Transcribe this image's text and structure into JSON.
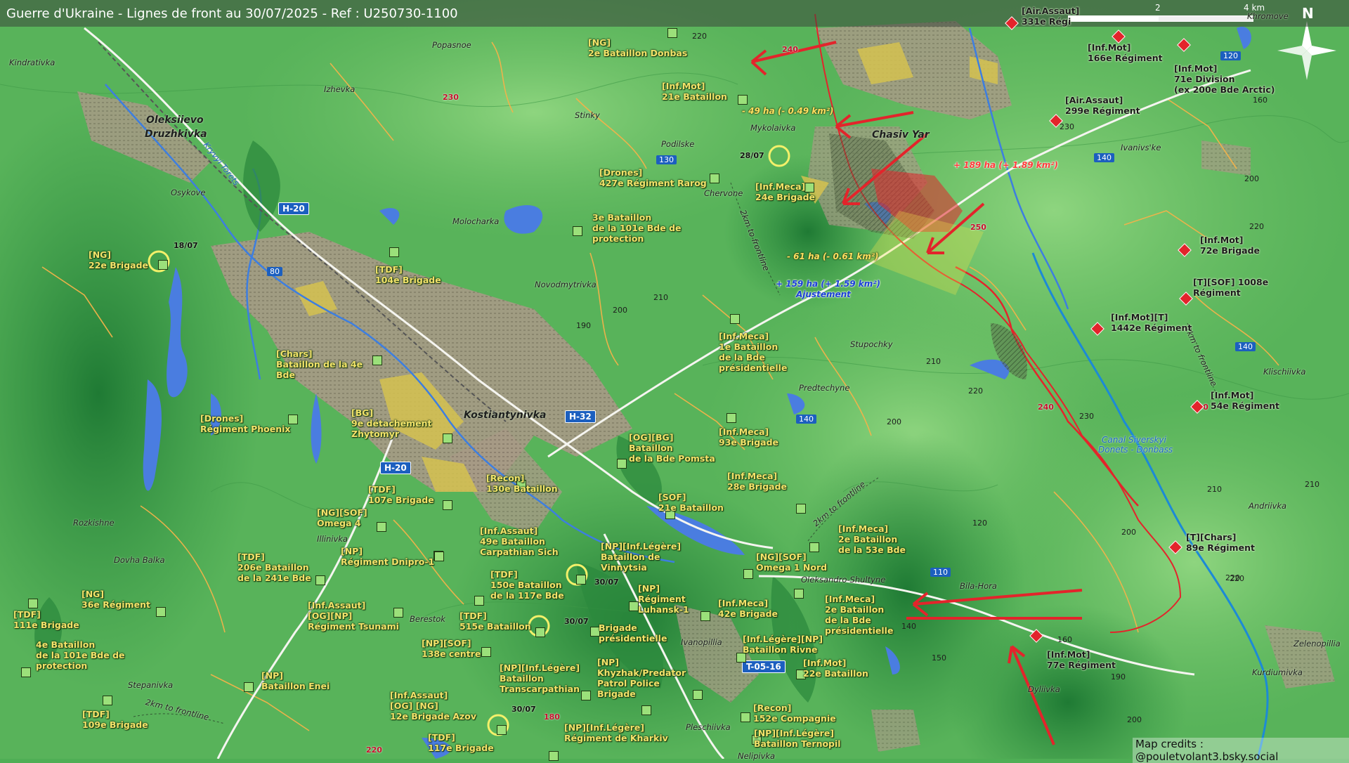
{
  "header": {
    "title": "Guerre d'Ukraine - Lignes de front au 30/07/2025 - Ref : U250730-1100"
  },
  "scale": {
    "mid_label": "2",
    "end_label": "4 km"
  },
  "compass": {
    "north_label": "N"
  },
  "credits": "Map credits : @pouletvolant3.bsky.social",
  "colors": {
    "ua_units": "#f3e36a",
    "ru_advance": "#e3242b",
    "frontline": "#e3242b",
    "canal": "#1c66c8",
    "highway_shield": "#1c5fbf"
  },
  "icons": {
    "ua_unit": "green-square-unit-icon",
    "ru_unit": "red-diamond-unit-icon",
    "arrow": "red-attack-arrow-icon",
    "north": "compass-star-icon"
  },
  "places": {
    "chasiv_yar": "Chasiv Yar",
    "kostiantynivka": "Kostiantynivka",
    "oleksiievo": "Oleksiievo",
    "druzhkivka": "Druzhkivka",
    "kindrativka": "Kindrativka",
    "popasnoe": "Popasnoe",
    "izhevka": "Izhevka",
    "stinky": "Stinky",
    "mykolaivka": "Mykolaivka",
    "podilske": "Podilske",
    "chervone": "Chervone",
    "molocharka": "Molocharka",
    "novodmytrivka": "Novodmytrivka",
    "stupochky": "Stupochky",
    "predtechyne": "Predtechyne",
    "osykove": "Osykove",
    "rozkishne": "Rozkishne",
    "illinivka": "Illinivka",
    "dovha_balka": "Dovha Balka",
    "berestok": "Berestok",
    "stepanivka": "Stepanivka",
    "ivanopillia": "Ivanopillia",
    "pleschiivka": "Pleschiivka",
    "nelipivka": "Nelipivka",
    "oleksandro_shultyne": "Oleksandro-Shultyne",
    "bila_hora": "Bila-Hora",
    "dyliivka": "Dyliivka",
    "ivanivske": "Ivanivs'ke",
    "klischiivka": "Klischiivka",
    "andriivka": "Andriivka",
    "zelenopillia": "Zelenopillia",
    "kurdiumivka": "Kurdiumivka",
    "khromove": "Khromove",
    "kryvyi_torets": "Kryvyi Torets"
  },
  "roads": {
    "h20a": "H-20",
    "h20b": "H-20",
    "h32": "H-32",
    "t0516": "T-05-16",
    "r80": "80",
    "r130": "130",
    "r140a": "140",
    "r140b": "140",
    "r140c": "140",
    "r110": "110",
    "r120": "120"
  },
  "elevations": [
    "220",
    "230",
    "240",
    "230",
    "200",
    "210",
    "190",
    "200",
    "210",
    "220",
    "250",
    "220",
    "230",
    "200",
    "210",
    "220",
    "200",
    "120",
    "140",
    "150",
    "160",
    "190",
    "200",
    "160",
    "220",
    "180",
    "220",
    "210",
    "240",
    "230"
  ],
  "annotations": {
    "loss1": "- 49 ha (- 0.49 km²)",
    "gain1": "+ 189 ha (+ 1.89 km²)",
    "loss2": "- 61 ha (- 0.61 km²)",
    "adj1": "+ 159 ha (+ 1.59 km²)",
    "adj2": "Ajustement",
    "frontline1": "2km to frontline",
    "frontline2": "2km to frontline",
    "frontline3": "2km to frontline",
    "frontline4": "2km to frontline",
    "canal1": "Canal Siverskyi",
    "canal2": "Donets - Donbass"
  },
  "dates": {
    "d1": "28/07",
    "d2": "18/07",
    "d3": "30/07",
    "d4": "30/07",
    "d5": "30/07"
  },
  "ua_units": [
    {
      "l1": "[NG]",
      "l2": "2e Bataillon Donbas"
    },
    {
      "l1": "[Inf.Mot]",
      "l2": "21e Bataillon"
    },
    {
      "l1": "[Drones]",
      "l2": "427e Régiment Rarog"
    },
    {
      "l1": "[Inf.Meca]",
      "l2": "24e Brigade"
    },
    {
      "l1": "3e Bataillon",
      "l2": "de la 101e Bde de",
      "l3": "protection"
    },
    {
      "l1": "[NG]",
      "l2": "22e Brigade"
    },
    {
      "l1": "[TDF]",
      "l2": "104e Brigade"
    },
    {
      "l1": "[Chars]",
      "l2": "Bataillon de la 4e",
      "l3": "Bde"
    },
    {
      "l1": "[Inf.Meca]",
      "l2": "1e Bataillon",
      "l3": "de la Bde",
      "l4": "présidentielle"
    },
    {
      "l1": "[Drones]",
      "l2": "Régiment Phoenix"
    },
    {
      "l1": "[BG]",
      "l2": "9e détachement",
      "l3": "Zhytomyr"
    },
    {
      "l1": "[Inf.Meca]",
      "l2": "93e Brigade"
    },
    {
      "l1": "[OG][BG]",
      "l2": "Bataillon",
      "l3": "de la Bde Pomsta"
    },
    {
      "l1": "[Recon]",
      "l2": "130e Bataillon"
    },
    {
      "l1": "[TDF]",
      "l2": "107e Brigade"
    },
    {
      "l1": "[Inf.Meca]",
      "l2": "28e Brigade"
    },
    {
      "l1": "[SOF]",
      "l2": "21e Bataillon"
    },
    {
      "l1": "[NG][SOF]",
      "l2": "Omega 4"
    },
    {
      "l1": "[Inf.Assaut]",
      "l2": "49e Bataillon",
      "l3": "Carpathian Sich"
    },
    {
      "l1": "[NP]",
      "l2": "Régiment Dnipro-1"
    },
    {
      "l1": "[TDF]",
      "l2": "206e Bataillon",
      "l3": "de la 241e Bde"
    },
    {
      "l1": "[NP][Inf.Légère]",
      "l2": "Bataillon de",
      "l3": "Vinnytsia"
    },
    {
      "l1": "[NG][SOF]",
      "l2": "Omega 1 Nord"
    },
    {
      "l1": "[Inf.Meca]",
      "l2": "2e Bataillon",
      "l3": "de la 53e Bde"
    },
    {
      "l1": "[TDF]",
      "l2": "150e Bataillon",
      "l3": "de la 117e Bde"
    },
    {
      "l1": "[NP]",
      "l2": "Régiment",
      "l3": "Luhansk-1"
    },
    {
      "l1": "[NG]",
      "l2": "36e Régiment"
    },
    {
      "l1": "[TDF]",
      "l2": "111e Brigade"
    },
    {
      "l1": "[Inf.Assaut]",
      "l2": "[OG][NP]",
      "l3": "Régiment Tsunami"
    },
    {
      "l1": "[TDF]",
      "l2": "515e Bataillon"
    },
    {
      "l1": "Brigade",
      "l2": "présidentielle"
    },
    {
      "l1": "[Inf.Meca]",
      "l2": "42e Brigade"
    },
    {
      "l1": "[Inf.Meca]",
      "l2": "2e Bataillon",
      "l3": "de la Bde",
      "l4": "présidentielle"
    },
    {
      "l1": "4e Bataillon",
      "l2": "de la 101e Bde de",
      "l3": "protection"
    },
    {
      "l1": "[NP][SOF]",
      "l2": "138e centre"
    },
    {
      "l1": "[Inf.Légère][NP]",
      "l2": "Bataillon Rivne"
    },
    {
      "l1": "[NP]",
      "l2": "Bataillon Enei"
    },
    {
      "l1": "[NP][Inf.Légère]",
      "l2": "Bataillon",
      "l3": "Transcarpathian"
    },
    {
      "l1": "[NP]",
      "l2": "Khyzhak/Predator",
      "l3": "Patrol Police",
      "l4": "Brigade"
    },
    {
      "l1": "[Inf.Mot]",
      "l2": "22e Bataillon"
    },
    {
      "l1": "[TDF]",
      "l2": "109e Brigade"
    },
    {
      "l1": "[Inf.Assaut]",
      "l2": "[OG] [NG]",
      "l3": "12e Brigade Azov"
    },
    {
      "l1": "[Recon]",
      "l2": "152e Compagnie"
    },
    {
      "l1": "[NP][Inf.Légère]",
      "l2": "Régiment de Kharkiv"
    },
    {
      "l1": "[NP][Inf.Légère]",
      "l2": "Bataillon Ternopil"
    },
    {
      "l1": "[TDF]",
      "l2": "117e Brigade"
    }
  ],
  "ru_units": [
    {
      "l1": "[Air.Assaut]",
      "l2": "331e Régi"
    },
    {
      "l1": "[Inf.Mot]",
      "l2": "166e Régiment"
    },
    {
      "l1": "[Inf.Mot]",
      "l2": "71e Division",
      "l3": "(ex 200e Bde Arctic)"
    },
    {
      "l1": "[Air.Assaut]",
      "l2": "299e Régiment"
    },
    {
      "l1": "[Inf.Mot]",
      "l2": "72e Brigade"
    },
    {
      "l1": "[T][SOF] 1008e",
      "l2": "Régiment"
    },
    {
      "l1": "[Inf.Mot][T]",
      "l2": "1442e Régiment"
    },
    {
      "l1": "[Inf.Mot]",
      "l2": "54e Régiment"
    },
    {
      "l1": "[T][Chars]",
      "l2": "89e Régiment"
    },
    {
      "l1": "[Inf.Mot]",
      "l2": "77e Régiment"
    }
  ]
}
